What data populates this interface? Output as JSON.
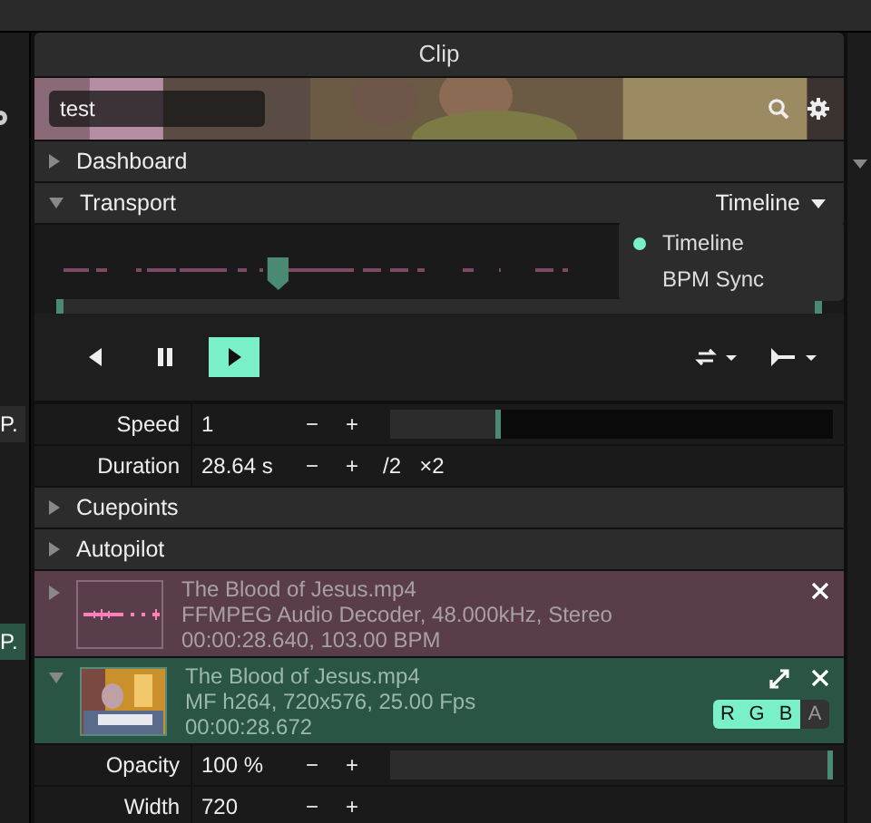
{
  "side_left": [
    {
      "label": "P.",
      "selected": false
    },
    {
      "label": "P.",
      "selected": true
    }
  ],
  "panel": {
    "title": "Clip"
  },
  "search": {
    "value": "test"
  },
  "sections_top": [
    {
      "label": "Dashboard",
      "expanded": false
    }
  ],
  "transport": {
    "label": "Transport",
    "expanded": true,
    "mode": "Timeline",
    "level": 0.29,
    "menu": [
      {
        "label": "Timeline",
        "selected": true
      },
      {
        "label": "BPM Sync",
        "selected": false
      }
    ],
    "buttons": [
      {
        "kind": "back",
        "selected": false
      },
      {
        "kind": "pause",
        "selected": false
      },
      {
        "kind": "play",
        "selected": true
      }
    ]
  },
  "params": [
    {
      "label": "Speed",
      "value": "1",
      "minus": "−",
      "plus": "+",
      "level": 0.25
    },
    {
      "label": "Duration",
      "value": "28.64 s",
      "minus": "−",
      "plus": "+",
      "extra": [
        "/2",
        "×2"
      ]
    }
  ],
  "sections_bottom": [
    {
      "label": "Cuepoints",
      "expanded": false
    },
    {
      "label": "Autopilot",
      "expanded": false
    }
  ],
  "layers": [
    {
      "kind": "audio",
      "expanded": false,
      "name": "The Blood of Jesus.mp4",
      "codec": "FFMPEG Audio Decoder, 48.000kHz, Stereo",
      "info": "00:00:28.640, 103.00 BPM"
    },
    {
      "kind": "video",
      "expanded": true,
      "name": "The Blood of Jesus.mp4",
      "codec": "MF h264, 720x576, 25.00 Fps",
      "info": "00:00:28.672",
      "channels": [
        {
          "label": "R",
          "on": true
        },
        {
          "label": "G",
          "on": true
        },
        {
          "label": "B",
          "on": true
        },
        {
          "label": "A",
          "on": false
        }
      ]
    }
  ],
  "layer_params": [
    {
      "label": "Opacity",
      "value": "100 %",
      "minus": "−",
      "plus": "+",
      "level": 1.0
    },
    {
      "label": "Width",
      "value": "720",
      "minus": "−",
      "plus": "+"
    }
  ]
}
